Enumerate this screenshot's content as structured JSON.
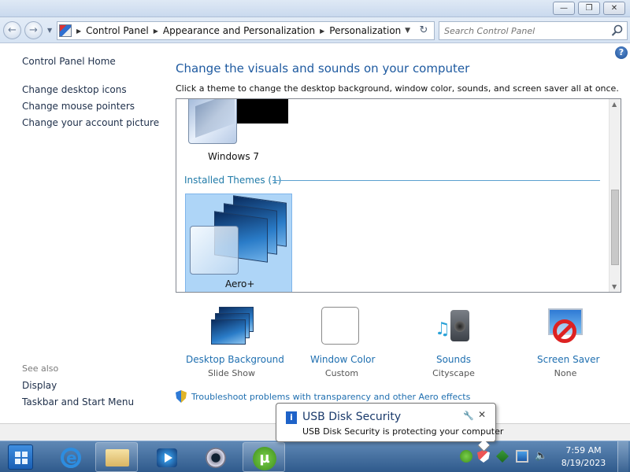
{
  "window": {
    "minimize_glyph": "—",
    "maximize_glyph": "❐",
    "close_glyph": "✕"
  },
  "address": {
    "crumbs": [
      "Control Panel",
      "Appearance and Personalization",
      "Personalization"
    ],
    "search_placeholder": "Search Control Panel"
  },
  "sidebar": {
    "home": "Control Panel Home",
    "links": [
      "Change desktop icons",
      "Change mouse pointers",
      "Change your account picture"
    ],
    "see_also_label": "See also",
    "see_also": [
      "Display",
      "Taskbar and Start Menu"
    ]
  },
  "main": {
    "heading": "Change the visuals and sounds on your computer",
    "instruction": "Click a theme to change the desktop background, window color, sounds, and screen saver all at once.",
    "themes": [
      {
        "name": "Windows 7"
      },
      {
        "name": "Aero+"
      }
    ],
    "installed_section": "Installed Themes (1)",
    "selected_theme": "Aero+"
  },
  "options": [
    {
      "title": "Desktop Background",
      "value": "Slide Show",
      "icon": "desktop-background-icon"
    },
    {
      "title": "Window Color",
      "value": "Custom",
      "icon": "window-color-icon"
    },
    {
      "title": "Sounds",
      "value": "Cityscape",
      "icon": "sounds-icon"
    },
    {
      "title": "Screen Saver",
      "value": "None",
      "icon": "screen-saver-icon"
    }
  ],
  "troubleshoot": "Troubleshoot problems with transparency and other Aero effects",
  "balloon": {
    "title": "USB Disk Security",
    "text": "USB Disk Security is protecting your computer"
  },
  "taskbar": {
    "apps": [
      "internet-explorer",
      "windows-explorer",
      "media-player",
      "webcam",
      "utorrent"
    ],
    "utorrent_glyph": "µ",
    "time": "7:59 AM",
    "date": "8/19/2023"
  },
  "colors": {
    "heading": "#1e5aa0",
    "link": "#1f6fb0",
    "selection": "#aed5f7",
    "taskbar": "#2f5a8c"
  }
}
